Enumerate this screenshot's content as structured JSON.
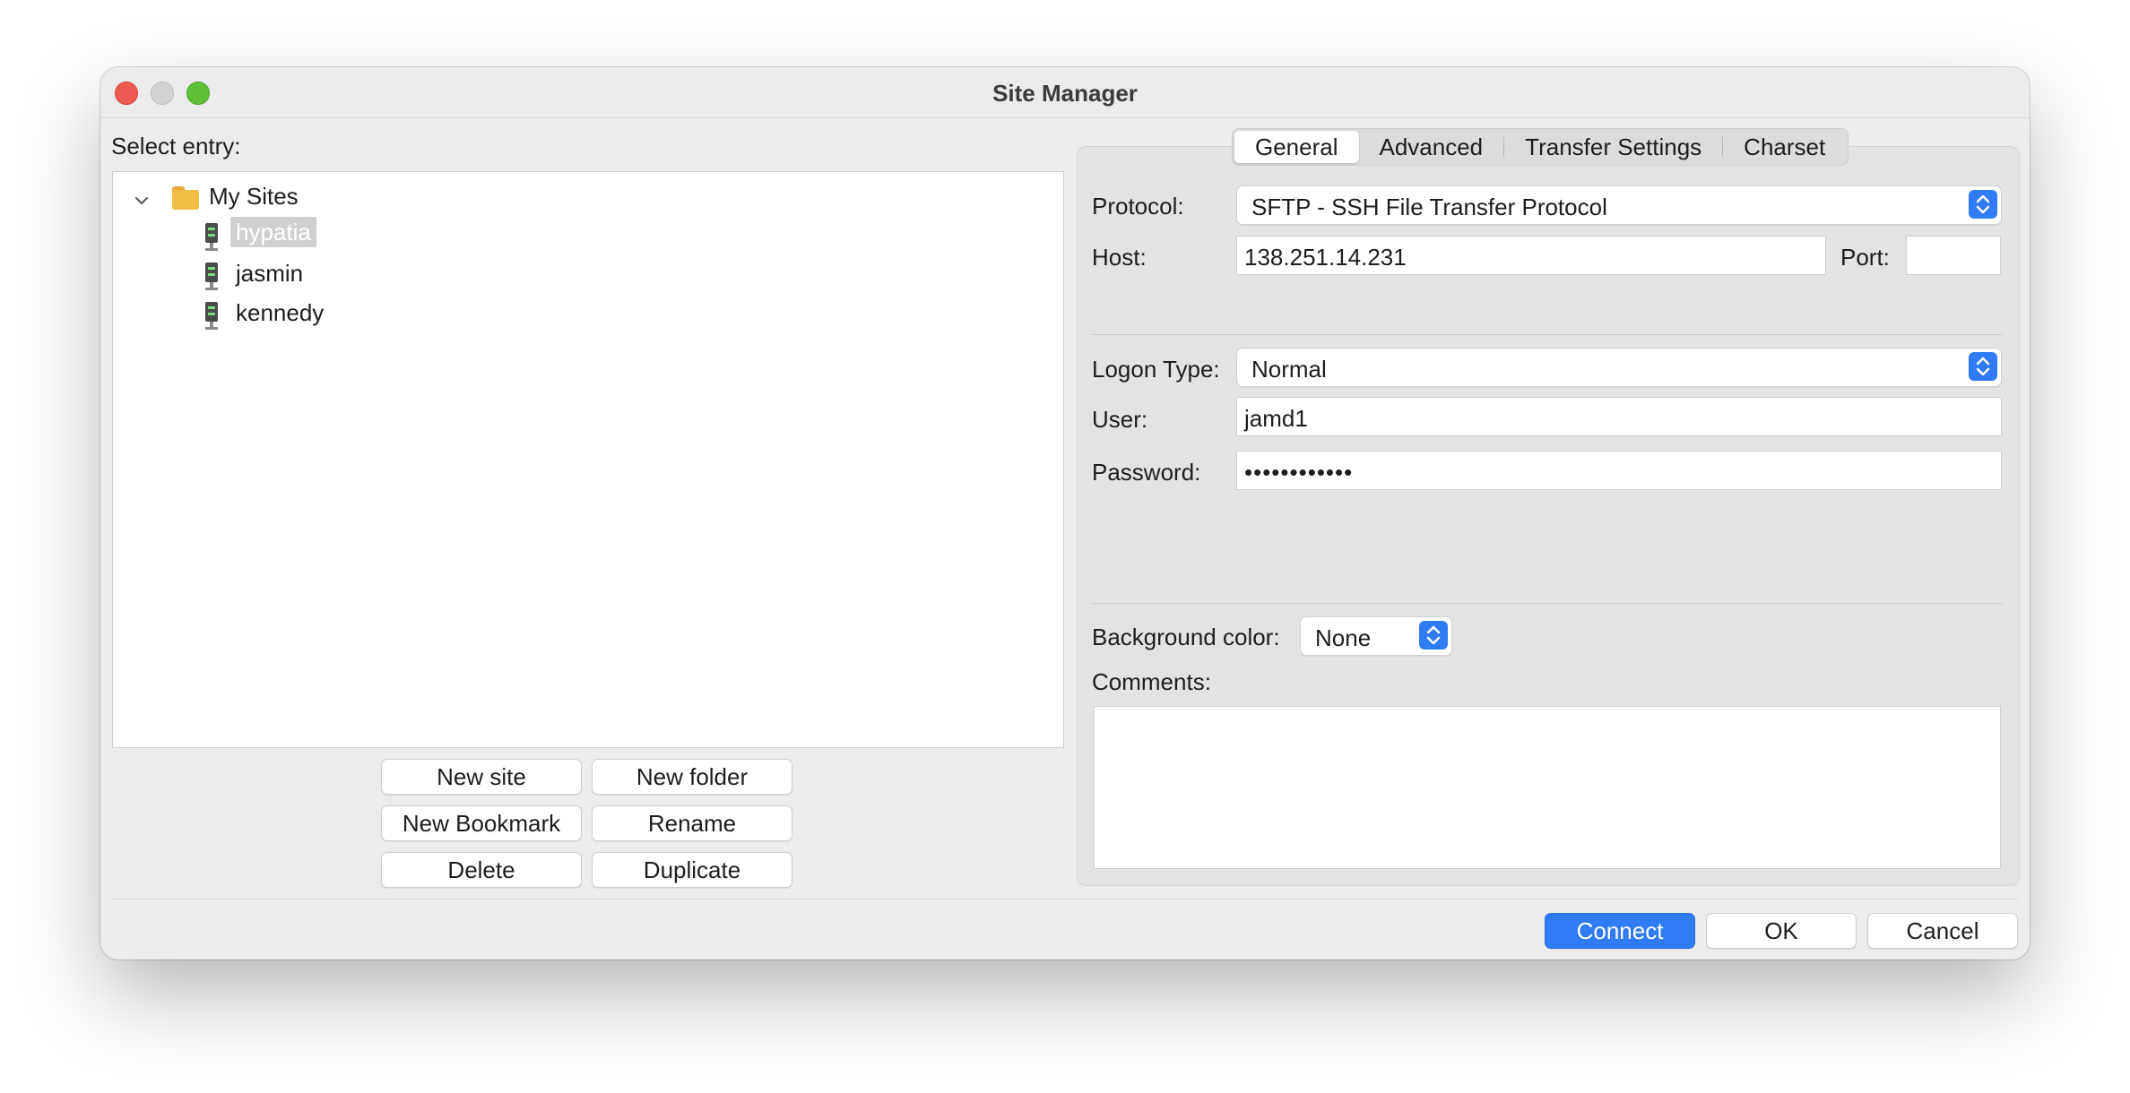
{
  "window": {
    "title": "Site Manager"
  },
  "left": {
    "select_entry_label": "Select entry:",
    "tree": {
      "root": {
        "label": "My Sites",
        "icon": "folder-icon",
        "expanded": true
      },
      "sites": [
        {
          "label": "hypatia",
          "selected": true
        },
        {
          "label": "jasmin",
          "selected": false
        },
        {
          "label": "kennedy",
          "selected": false
        }
      ]
    },
    "buttons": {
      "new_site": "New site",
      "new_folder": "New folder",
      "new_bookmark": "New Bookmark",
      "rename": "Rename",
      "delete": "Delete",
      "duplicate": "Duplicate"
    }
  },
  "tabs": [
    {
      "label": "General",
      "active": true
    },
    {
      "label": "Advanced",
      "active": false
    },
    {
      "label": "Transfer Settings",
      "active": false
    },
    {
      "label": "Charset",
      "active": false
    }
  ],
  "general": {
    "protocol_label": "Protocol:",
    "protocol_value": "SFTP - SSH File Transfer Protocol",
    "host_label": "Host:",
    "host_value": "138.251.14.231",
    "port_label": "Port:",
    "port_value": "",
    "logon_type_label": "Logon Type:",
    "logon_type_value": "Normal",
    "user_label": "User:",
    "user_value": "jamd1",
    "password_label": "Password:",
    "password_value": "••••••••••••",
    "background_color_label": "Background color:",
    "background_color_value": "None",
    "comments_label": "Comments:",
    "comments_value": ""
  },
  "footer": {
    "connect": "Connect",
    "ok": "OK",
    "cancel": "Cancel"
  },
  "colors": {
    "accent": "#2f7cf6",
    "selection": "#d0d0d0",
    "window_bg": "#ececec"
  }
}
